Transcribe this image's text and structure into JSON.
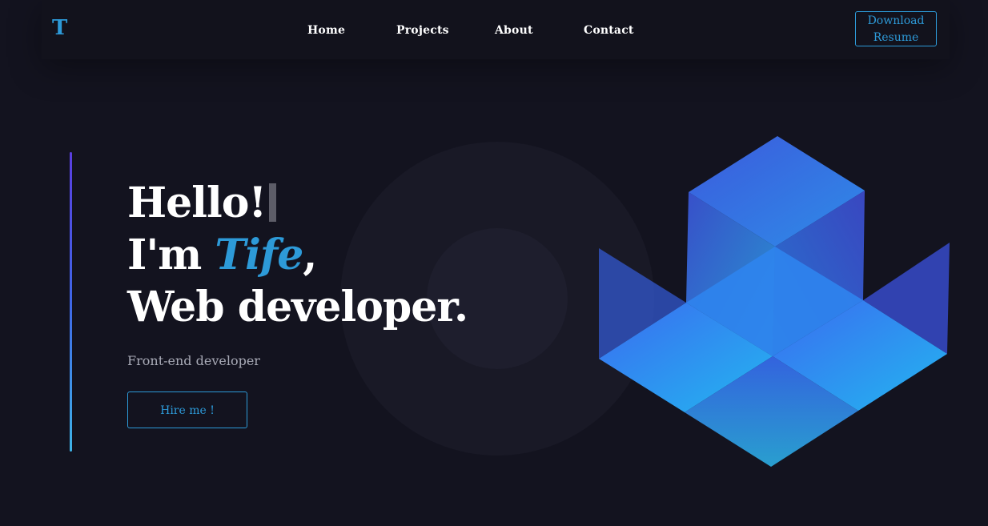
{
  "header": {
    "logo": "T",
    "nav": [
      {
        "label": "Home"
      },
      {
        "label": "Projects"
      },
      {
        "label": "About"
      },
      {
        "label": "Contact"
      }
    ],
    "download_line1": "Download",
    "download_line2": "Resume"
  },
  "hero": {
    "greeting": "Hello!",
    "intro_prefix": "I'm ",
    "name": "Tife",
    "intro_suffix": ",",
    "role": "Web developer.",
    "subtitle": "Front-end developer",
    "cta": "Hire me !"
  },
  "colors": {
    "accent": "#2d9ad8",
    "background": "#13131f",
    "text": "#ffffff",
    "muted": "#a8aab6"
  },
  "icons": {
    "hero_art": "isometric-cubes-icon",
    "cursor": "text-cursor-icon"
  }
}
